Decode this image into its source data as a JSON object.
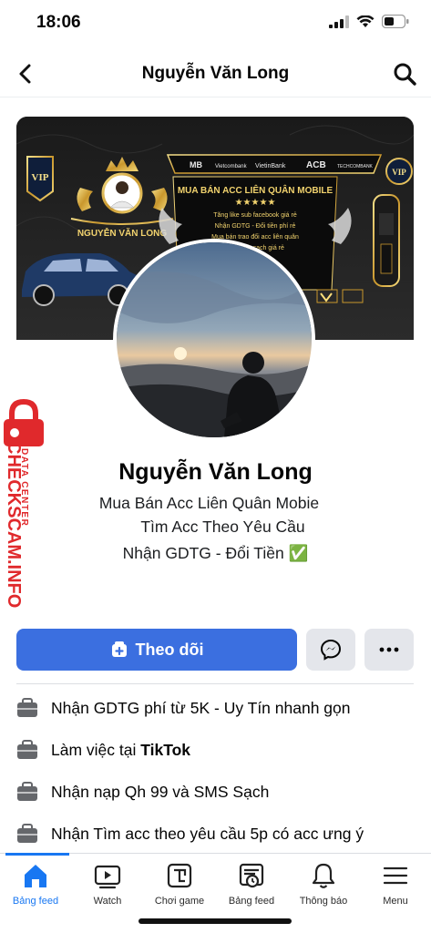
{
  "status": {
    "time": "18:06"
  },
  "nav": {
    "title": "Nguyễn Văn Long"
  },
  "cover": {
    "vip": "VIP",
    "name": "NGUYỄN VĂN LONG",
    "banks": [
      "MB",
      "Vietcombank",
      "VietinBank",
      "ACB",
      "TECHCOMBANK"
    ],
    "headline": "MUA BÁN ACC LIÊN QUÂN MOBILE",
    "stars": "★★★★★",
    "lines": [
      "Tăng like sub facebook giá rẻ",
      "Nhận GDTG - Đổi tiền phí rẻ",
      "Mua bán trao đổi acc liên quân",
      "...99 - gh sạch giá rẻ"
    ]
  },
  "watermark": {
    "top": "DATA CENTER",
    "main": "CHECKSCAM.INFO"
  },
  "profile": {
    "name": "Nguyễn Văn Long",
    "bio_line1": "Mua Bán Acc Liên Quân Mobie",
    "bio_line2": "Tìm Acc Theo Yêu Cầu",
    "bio_line3": "Nhận GDTG - Đổi Tiền ✅"
  },
  "actions": {
    "follow": "Theo dõi"
  },
  "intro": [
    {
      "icon": "briefcase-icon",
      "text": "Nhận GDTG phí từ 5K  - Uy Tín nhanh gọn"
    },
    {
      "icon": "briefcase-icon",
      "prefix": "Làm việc tại ",
      "bold": "TikTok"
    },
    {
      "icon": "briefcase-icon",
      "text": "Nhận nạp Qh 99 và SMS Sạch"
    },
    {
      "icon": "briefcase-icon",
      "text": "Nhận Tìm acc theo yêu cầu 5p có acc ưng ý"
    }
  ],
  "tabs": [
    {
      "label": "Bảng feed",
      "icon": "home-icon",
      "active": true
    },
    {
      "label": "Watch",
      "icon": "watch-icon"
    },
    {
      "label": "Chơi game",
      "icon": "gaming-icon"
    },
    {
      "label": "Bảng feed",
      "icon": "feeds-icon"
    },
    {
      "label": "Thông báo",
      "icon": "bell-icon"
    },
    {
      "label": "Menu",
      "icon": "menu-icon"
    }
  ],
  "colors": {
    "accent": "#1877f2",
    "follow_button": "#3b6fe0",
    "secondary_button": "#e4e6eb",
    "watermark": "#e0292c"
  }
}
